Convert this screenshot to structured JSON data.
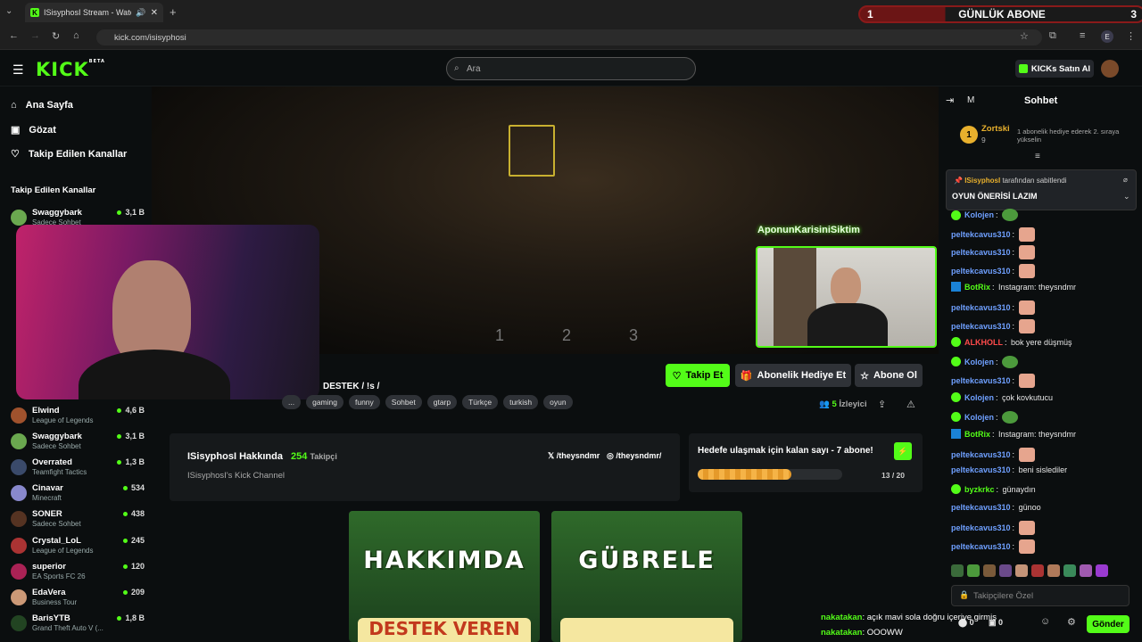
{
  "browser": {
    "tab_title": "ISisyphosI Stream - Watch",
    "url": "kick.com/isisyphosi",
    "profile_initial": "E"
  },
  "sub_banner": {
    "left": "1",
    "title": "GÜNLÜK ABONE",
    "right": "3"
  },
  "header": {
    "logo": "KICK",
    "logo_badge": "BETA",
    "search_placeholder": "Ara",
    "buy_kicks": "KICKs Satın Al"
  },
  "sidebar": {
    "nav": [
      {
        "label": "Ana Sayfa",
        "icon": "home-icon"
      },
      {
        "label": "Gözat",
        "icon": "browse-icon"
      },
      {
        "label": "Takip Edilen Kanallar",
        "icon": "heart-icon"
      }
    ],
    "section_title": "Takip Edilen Kanallar",
    "channels": [
      {
        "name": "Swaggybark",
        "game": "Sadece Sohbet",
        "viewers": "3,1 B",
        "color": "#6aa84f"
      },
      {
        "name": "Elwind",
        "game": "League of Legends",
        "viewers": "4,6 B",
        "color": "#a0522d"
      },
      {
        "name": "Swaggybark",
        "game": "Sadece Sohbet",
        "viewers": "3,1 B",
        "color": "#6aa84f"
      },
      {
        "name": "Overrated",
        "game": "Teamfight Tactics",
        "viewers": "1,3 B",
        "color": "#3a4a6a"
      },
      {
        "name": "Cinavar",
        "game": "Minecraft",
        "viewers": "534",
        "color": "#8888cc"
      },
      {
        "name": "SONER",
        "game": "Sadece Sohbet",
        "viewers": "438",
        "color": "#553322"
      },
      {
        "name": "Crystal_LoL",
        "game": "League of Legends",
        "viewers": "245",
        "color": "#aa3333"
      },
      {
        "name": "superior",
        "game": "EA Sports FC 26",
        "viewers": "120",
        "color": "#aa2255"
      },
      {
        "name": "EdaVera",
        "game": "Business Tour",
        "viewers": "209",
        "color": "#cc9977"
      },
      {
        "name": "BarisYTB",
        "game": "Grand Theft Auto V (...",
        "viewers": "1,8 B",
        "color": "#224422"
      }
    ]
  },
  "stream": {
    "cam_overlay_label": "AponunKarisiniSiktim",
    "overlay_numbers": "1 2 3",
    "title_fragment": "DESTEK / !s /",
    "tags": [
      "...",
      "gaming",
      "funny",
      "Sohbet",
      "gtarp",
      "Türkçe",
      "turkish",
      "oyun"
    ],
    "follow_label": "Takip Et",
    "gift_label": "Abonelik Hediye Et",
    "subscribe_label": "Abone Ol",
    "viewers_count": "5",
    "viewers_label": "İzleyici"
  },
  "about": {
    "title": "ISisyphosI Hakkında",
    "followers_count": "254",
    "followers_label": "Takipçi",
    "description": "ISisyphosI's Kick Channel",
    "x_handle": "/theysndmr",
    "instagram_handle": "/theysndmr/"
  },
  "goal": {
    "text": "Hedefe ulaşmak için kalan sayı - 7 abone!",
    "current": 13,
    "total": 20,
    "progress_text": "13 / 20",
    "progress_fraction": 0.65
  },
  "panels": [
    {
      "title": "HAKKIMDA",
      "bottom": "DESTEK VEREN"
    },
    {
      "title": "GÜBRELE",
      "bottom": ""
    }
  ],
  "chat": {
    "title": "Sohbet",
    "mode_letter": "M",
    "top_gifter": {
      "name": "Zortski",
      "count": "9",
      "rank": "1",
      "note": "1 abonelik hediye ederek 2. sıraya yükselin"
    },
    "pinned": {
      "by": "ISisyphosI",
      "by_suffix": "tarafından sabitlendi",
      "text": "OYUN ÖNERİSİ LAZIM"
    },
    "messages": [
      {
        "user": "Kolojen",
        "text": "",
        "color": "#6fa0ff",
        "emote": "green"
      },
      {
        "user": "peltekcavus310",
        "text": "",
        "color": "#6fa0ff",
        "emote": "face"
      },
      {
        "user": "peltekcavus310",
        "text": "",
        "color": "#6fa0ff",
        "emote": "face"
      },
      {
        "user": "peltekcavus310",
        "text": "",
        "color": "#6fa0ff",
        "emote": "face"
      },
      {
        "user": "BotRix",
        "text": "Instagram: theysndmr",
        "color": "#53fc18",
        "emote": ""
      },
      {
        "user": "peltekcavus310",
        "text": "",
        "color": "#6fa0ff",
        "emote": "face"
      },
      {
        "user": "peltekcavus310",
        "text": "",
        "color": "#6fa0ff",
        "emote": "face"
      },
      {
        "user": "ALKHOLL",
        "text": "bok yere düşmüş",
        "color": "#ff4b4b",
        "emote": ""
      },
      {
        "user": "Kolojen",
        "text": "",
        "color": "#6fa0ff",
        "emote": "green"
      },
      {
        "user": "peltekcavus310",
        "text": "",
        "color": "#6fa0ff",
        "emote": "face"
      },
      {
        "user": "Kolojen",
        "text": "çok kovkutucu",
        "color": "#6fa0ff",
        "emote": ""
      },
      {
        "user": "Kolojen",
        "text": "",
        "color": "#6fa0ff",
        "emote": "green"
      },
      {
        "user": "BotRix",
        "text": "Instagram: theysndmr",
        "color": "#53fc18",
        "emote": ""
      },
      {
        "user": "peltekcavus310",
        "text": "",
        "color": "#6fa0ff",
        "emote": "face"
      },
      {
        "user": "peltekcavus310",
        "text": "beni sislediler",
        "color": "#6fa0ff",
        "emote": ""
      },
      {
        "user": "byzkrkc",
        "text": "günaydın",
        "color": "#53fc18",
        "emote": ""
      },
      {
        "user": "peltekcavus310",
        "text": "günoo",
        "color": "#6fa0ff",
        "emote": ""
      },
      {
        "user": "peltekcavus310",
        "text": "",
        "color": "#6fa0ff",
        "emote": "face"
      },
      {
        "user": "peltekcavus310",
        "text": "",
        "color": "#6fa0ff",
        "emote": "face"
      }
    ],
    "input_placeholder": "Takipçilere Özel",
    "send_label": "Gönder",
    "counter_a": "0",
    "counter_b": "0"
  },
  "overlay_chat": [
    {
      "user": "nakatakan",
      "text": "açık mavi sola doğru içeriye girmiş"
    },
    {
      "user": "nakatakan",
      "text": "OOOWW"
    }
  ],
  "colors": {
    "accent": "#53fc18",
    "bg": "#0b0e0f",
    "panel": "#16191b"
  }
}
